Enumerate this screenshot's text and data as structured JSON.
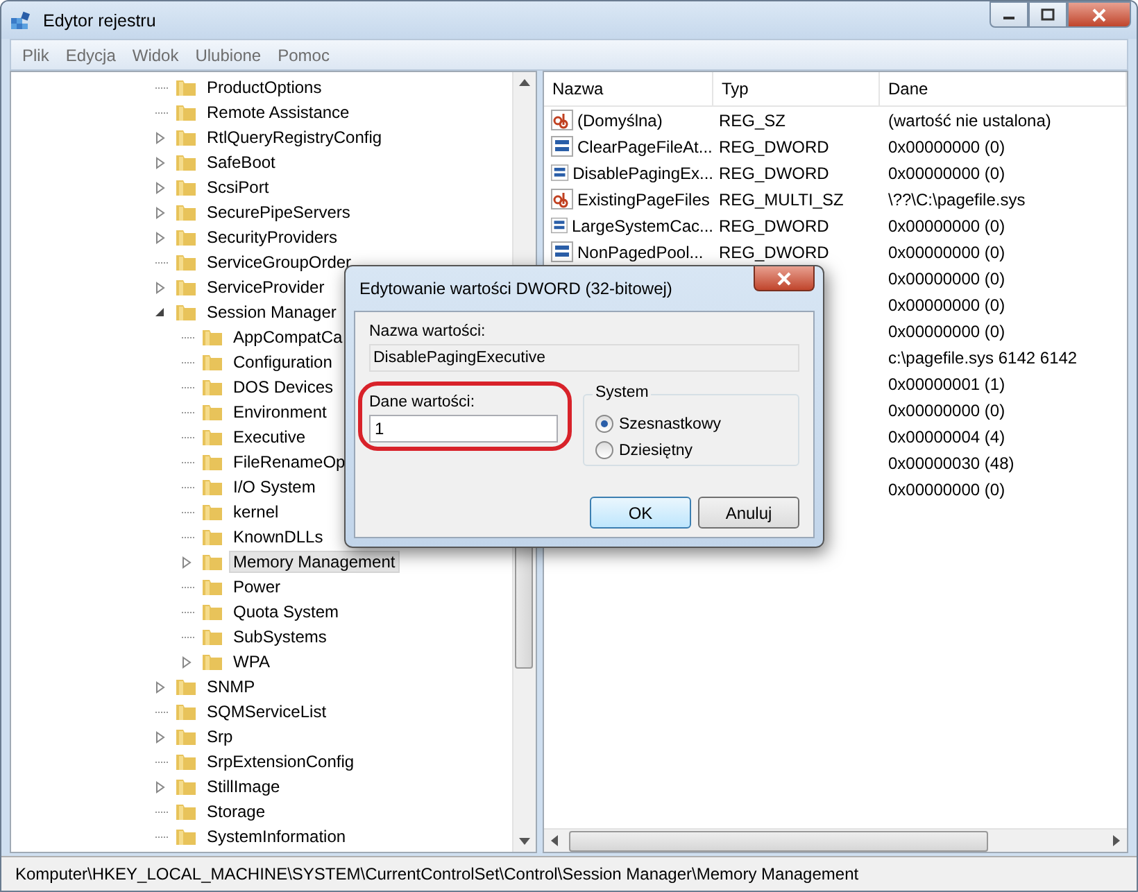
{
  "window": {
    "title": "Edytor rejestru"
  },
  "menu": [
    {
      "label": "Plik"
    },
    {
      "label": "Edycja"
    },
    {
      "label": "Widok"
    },
    {
      "label": "Ulubione"
    },
    {
      "label": "Pomoc"
    }
  ],
  "tree": {
    "items": [
      {
        "label": "ProductOptions",
        "kind": "leaf",
        "expanded": false,
        "selected": false
      },
      {
        "label": "Remote Assistance",
        "kind": "leaf",
        "expanded": false,
        "selected": false
      },
      {
        "label": "RtlQueryRegistryConfig",
        "kind": "node",
        "expanded": false,
        "selected": false
      },
      {
        "label": "SafeBoot",
        "kind": "node",
        "expanded": false,
        "selected": false
      },
      {
        "label": "ScsiPort",
        "kind": "node",
        "expanded": false,
        "selected": false
      },
      {
        "label": "SecurePipeServers",
        "kind": "node",
        "expanded": false,
        "selected": false
      },
      {
        "label": "SecurityProviders",
        "kind": "node",
        "expanded": false,
        "selected": false
      },
      {
        "label": "ServiceGroupOrder",
        "kind": "leaf",
        "expanded": false,
        "selected": false
      },
      {
        "label": "ServiceProvider",
        "kind": "node",
        "expanded": false,
        "selected": false
      },
      {
        "label": "Session Manager",
        "kind": "node",
        "expanded": true,
        "selected": false,
        "children": [
          {
            "label": "AppCompatCa",
            "kind": "leaf",
            "expanded": false,
            "selected": false
          },
          {
            "label": "Configuration",
            "kind": "leaf",
            "expanded": false,
            "selected": false
          },
          {
            "label": "DOS Devices",
            "kind": "leaf",
            "expanded": false,
            "selected": false
          },
          {
            "label": "Environment",
            "kind": "leaf",
            "expanded": false,
            "selected": false
          },
          {
            "label": "Executive",
            "kind": "leaf",
            "expanded": false,
            "selected": false
          },
          {
            "label": "FileRenameOp",
            "kind": "leaf",
            "expanded": false,
            "selected": false
          },
          {
            "label": "I/O System",
            "kind": "leaf",
            "expanded": false,
            "selected": false
          },
          {
            "label": "kernel",
            "kind": "leaf",
            "expanded": false,
            "selected": false
          },
          {
            "label": "KnownDLLs",
            "kind": "leaf",
            "expanded": false,
            "selected": false
          },
          {
            "label": "Memory Management",
            "kind": "node",
            "expanded": false,
            "selected": true
          },
          {
            "label": "Power",
            "kind": "leaf",
            "expanded": false,
            "selected": false
          },
          {
            "label": "Quota System",
            "kind": "leaf",
            "expanded": false,
            "selected": false
          },
          {
            "label": "SubSystems",
            "kind": "leaf",
            "expanded": false,
            "selected": false
          },
          {
            "label": "WPA",
            "kind": "node",
            "expanded": false,
            "selected": false
          }
        ]
      },
      {
        "label": "SNMP",
        "kind": "node",
        "expanded": false,
        "selected": false
      },
      {
        "label": "SQMServiceList",
        "kind": "leaf",
        "expanded": false,
        "selected": false
      },
      {
        "label": "Srp",
        "kind": "node",
        "expanded": false,
        "selected": false
      },
      {
        "label": "SrpExtensionConfig",
        "kind": "leaf",
        "expanded": false,
        "selected": false
      },
      {
        "label": "StillImage",
        "kind": "node",
        "expanded": false,
        "selected": false
      },
      {
        "label": "Storage",
        "kind": "leaf",
        "expanded": false,
        "selected": false
      },
      {
        "label": "SystemInformation",
        "kind": "leaf",
        "expanded": false,
        "selected": false
      }
    ]
  },
  "values": {
    "columns": [
      "Nazwa",
      "Typ",
      "Dane"
    ],
    "rows": [
      {
        "kind": "string",
        "name": "(Domyślna)",
        "type": "REG_SZ",
        "data": "(wartość nie ustalona)"
      },
      {
        "kind": "binary",
        "name": "ClearPageFileAt...",
        "type": "REG_DWORD",
        "data": "0x00000000 (0)"
      },
      {
        "kind": "binary",
        "name": "DisablePagingEx...",
        "type": "REG_DWORD",
        "data": "0x00000000 (0)"
      },
      {
        "kind": "string",
        "name": "ExistingPageFiles",
        "type": "REG_MULTI_SZ",
        "data": "\\??\\C:\\pagefile.sys"
      },
      {
        "kind": "binary",
        "name": "LargeSystemCac...",
        "type": "REG_DWORD",
        "data": "0x00000000 (0)"
      },
      {
        "kind": "binary",
        "name": "NonPagedPool...",
        "type": "REG_DWORD",
        "data": "0x00000000 (0)"
      },
      {
        "kind": "hidden",
        "data": "0x00000000 (0)"
      },
      {
        "kind": "hidden",
        "data": "0x00000000 (0)"
      },
      {
        "kind": "hidden",
        "data": "0x00000000 (0)"
      },
      {
        "kind": "hidden",
        "data": "c:\\pagefile.sys 6142 6142"
      },
      {
        "kind": "hidden",
        "data": "0x00000001 (1)"
      },
      {
        "kind": "hidden",
        "data": "0x00000000 (0)"
      },
      {
        "kind": "hidden",
        "data": "0x00000004 (4)"
      },
      {
        "kind": "hidden",
        "data": "0x00000030 (48)"
      },
      {
        "kind": "hidden",
        "data": "0x00000000 (0)"
      }
    ]
  },
  "status_bar": "Komputer\\HKEY_LOCAL_MACHINE\\SYSTEM\\CurrentControlSet\\Control\\Session Manager\\Memory Management",
  "dialog": {
    "title": "Edytowanie wartości DWORD (32-bitowej)",
    "name_label": "Nazwa wartości:",
    "name_value": "DisablePagingExecutive",
    "data_label": "Dane wartości:",
    "data_value": "1",
    "base_group": "System",
    "bases": [
      {
        "label": "Szesnastkowy",
        "selected": true
      },
      {
        "label": "Dziesiętny",
        "selected": false
      }
    ],
    "buttons": [
      "OK",
      "Anuluj"
    ]
  }
}
